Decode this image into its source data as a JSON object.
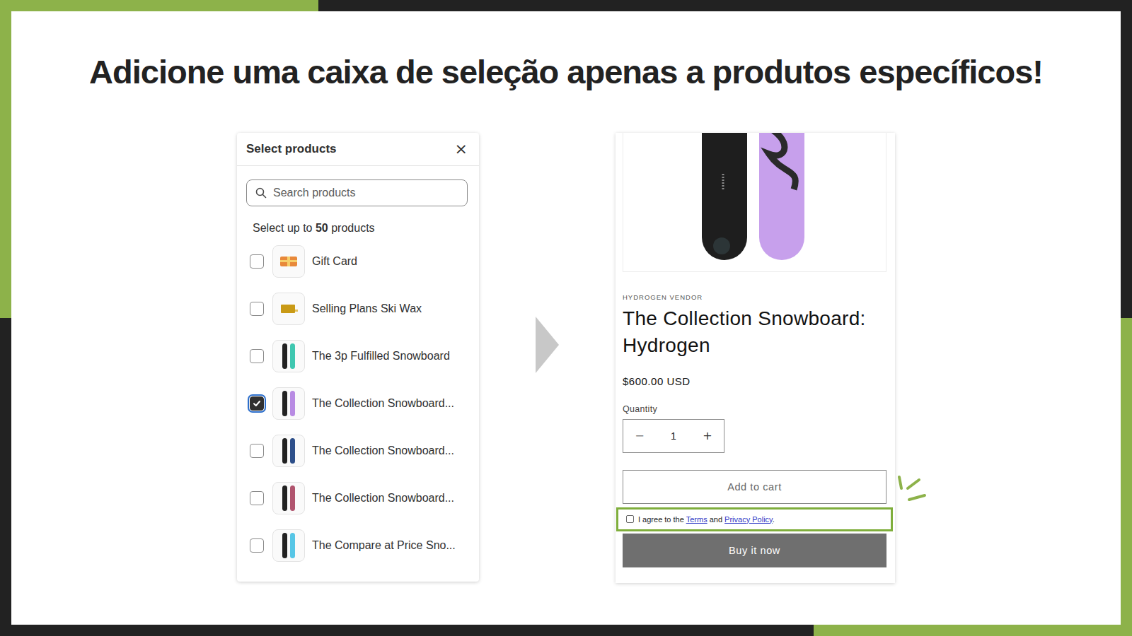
{
  "heading": "Adicione uma caixa de seleção apenas a produtos específicos!",
  "picker": {
    "title": "Select products",
    "close": "×",
    "search": {
      "placeholder": "Search products"
    },
    "limit": {
      "prefix": "Select up to",
      "count": "50",
      "suffix": "products"
    },
    "products": [
      {
        "name": "Gift Card",
        "checked": false,
        "kind": "card",
        "color": "#e8893a"
      },
      {
        "name": "Selling Plans Ski Wax",
        "checked": false,
        "kind": "wax",
        "color": "#c99a16"
      },
      {
        "name": "The 3p Fulfilled Snowboard",
        "checked": false,
        "kind": "board",
        "color": "#3fc7b0"
      },
      {
        "name": "The Collection Snowboard...",
        "checked": true,
        "kind": "board",
        "color": "#b88be3"
      },
      {
        "name": "The Collection Snowboard...",
        "checked": false,
        "kind": "board",
        "color": "#2d4f8a"
      },
      {
        "name": "The Collection Snowboard...",
        "checked": false,
        "kind": "board",
        "color": "#b0546e"
      },
      {
        "name": "The Compare at Price Sno...",
        "checked": false,
        "kind": "board",
        "color": "#57c6e6"
      }
    ]
  },
  "product": {
    "vendor": "HYDROGEN VENDOR",
    "title": "The Collection Snowboard: Hydrogen",
    "price": "$600.00 USD",
    "quantity": {
      "label": "Quantity",
      "decrease": "−",
      "value": "1",
      "increase": "+"
    },
    "add_to_cart": "Add to cart",
    "agreement": {
      "checked": false,
      "highlighted": true,
      "prefix": "I agree to the",
      "terms": "Terms",
      "and": "and",
      "privacy": "Privacy Policy",
      "end": "."
    },
    "buy_now": "Buy it now"
  }
}
